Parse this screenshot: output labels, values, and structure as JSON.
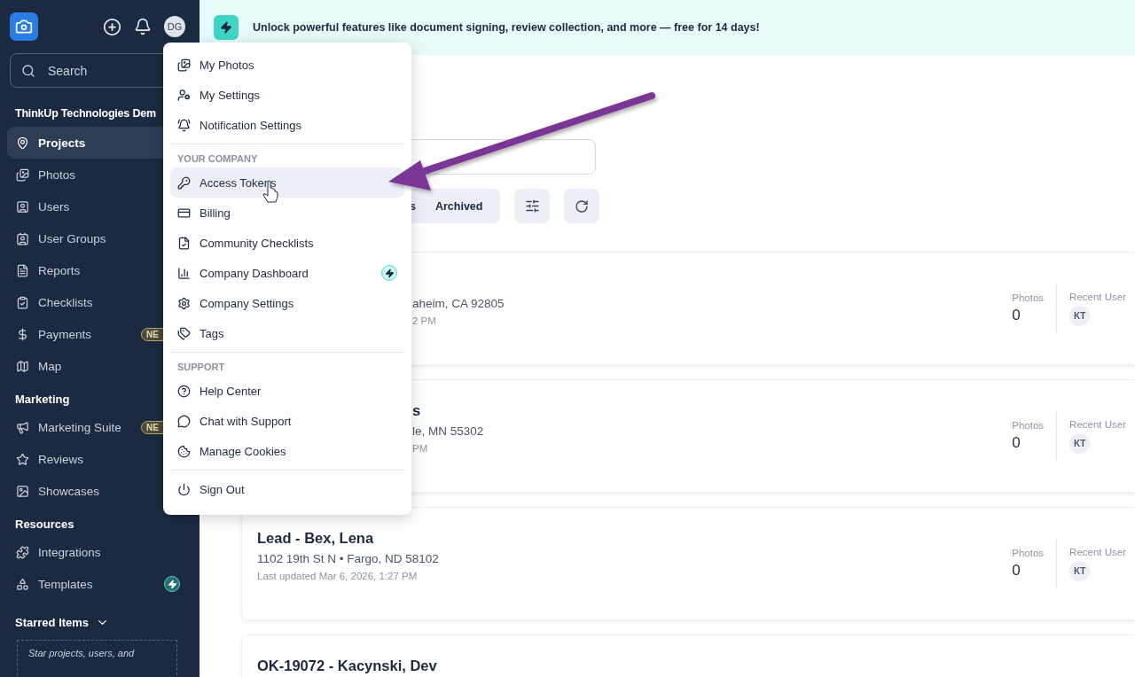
{
  "sidebar": {
    "avatar": "DG",
    "search": {
      "placeholder": "Search"
    },
    "company": "ThinkUp Technologies Dem",
    "items": [
      {
        "label": "Projects",
        "selected": true
      },
      {
        "label": "Photos",
        "selected": false
      },
      {
        "label": "Users",
        "selected": false
      },
      {
        "label": "User Groups",
        "selected": false
      },
      {
        "label": "Reports",
        "selected": false
      },
      {
        "label": "Checklists",
        "selected": false
      },
      {
        "label": "Payments",
        "selected": false,
        "badge": "NE"
      },
      {
        "label": "Map",
        "selected": false
      }
    ],
    "sections": [
      {
        "title": "Marketing",
        "items": [
          {
            "label": "Marketing Suite",
            "selected": false,
            "badge": "NE"
          },
          {
            "label": "Reviews",
            "selected": false
          },
          {
            "label": "Showcases",
            "selected": false
          }
        ]
      },
      {
        "title": "Resources",
        "items": [
          {
            "label": "Integrations",
            "selected": false
          },
          {
            "label": "Templates",
            "selected": false,
            "upgrade": true
          }
        ]
      }
    ],
    "starred": {
      "title": "Starred Items",
      "expanded": true,
      "hint": "Star projects, users, and"
    }
  },
  "banner": {
    "text": "Unlock powerful features like document signing, review collection, and more — free for 14 days!"
  },
  "menu": {
    "groups": [
      {
        "items": [
          {
            "label": "My Photos",
            "selected": false
          },
          {
            "label": "My Settings",
            "selected": false
          },
          {
            "label": "Notification Settings",
            "selected": false
          }
        ]
      },
      {
        "heading": "YOUR COMPANY",
        "items": [
          {
            "label": "Access Tokens",
            "selected": true
          },
          {
            "label": "Billing",
            "selected": false
          },
          {
            "label": "Community Checklists",
            "selected": false
          },
          {
            "label": "Company Dashboard",
            "selected": false,
            "upgrade": true
          },
          {
            "label": "Company Settings",
            "selected": false
          },
          {
            "label": "Tags",
            "selected": false
          }
        ]
      },
      {
        "heading": "SUPPORT",
        "items": [
          {
            "label": "Help Center",
            "selected": false
          },
          {
            "label": "Chat with Support",
            "selected": false
          },
          {
            "label": "Manage Cookies",
            "selected": false
          }
        ]
      },
      {
        "items": [
          {
            "label": "Sign Out",
            "selected": false
          }
        ]
      }
    ]
  },
  "filters": {
    "segments": [
      {
        "label": "s",
        "selected": false
      },
      {
        "label": "Archived",
        "selected": false
      }
    ]
  },
  "projects": [
    {
      "covered": true,
      "address": "aheim, CA 92805",
      "updated": "2 PM",
      "photos_label": "Photos",
      "photos": "0",
      "user_label": "Recent User",
      "user": "KT"
    },
    {
      "covered": true,
      "title": "s",
      "address": "le, MN 55302",
      "updated": "PM",
      "photos_label": "Photos",
      "photos": "0",
      "user_label": "Recent User",
      "user": "KT"
    },
    {
      "covered": false,
      "title": "Lead - Bex, Lena",
      "address": "1102 19th St N • Fargo, ND 58102",
      "updated": "Last updated Mar 6, 2026, 1:27 PM",
      "photos_label": "Photos",
      "photos": "0",
      "user_label": "Recent User",
      "user": "KT"
    },
    {
      "covered": false,
      "title": "OK-19072 - Kacynski, Dev"
    }
  ]
}
